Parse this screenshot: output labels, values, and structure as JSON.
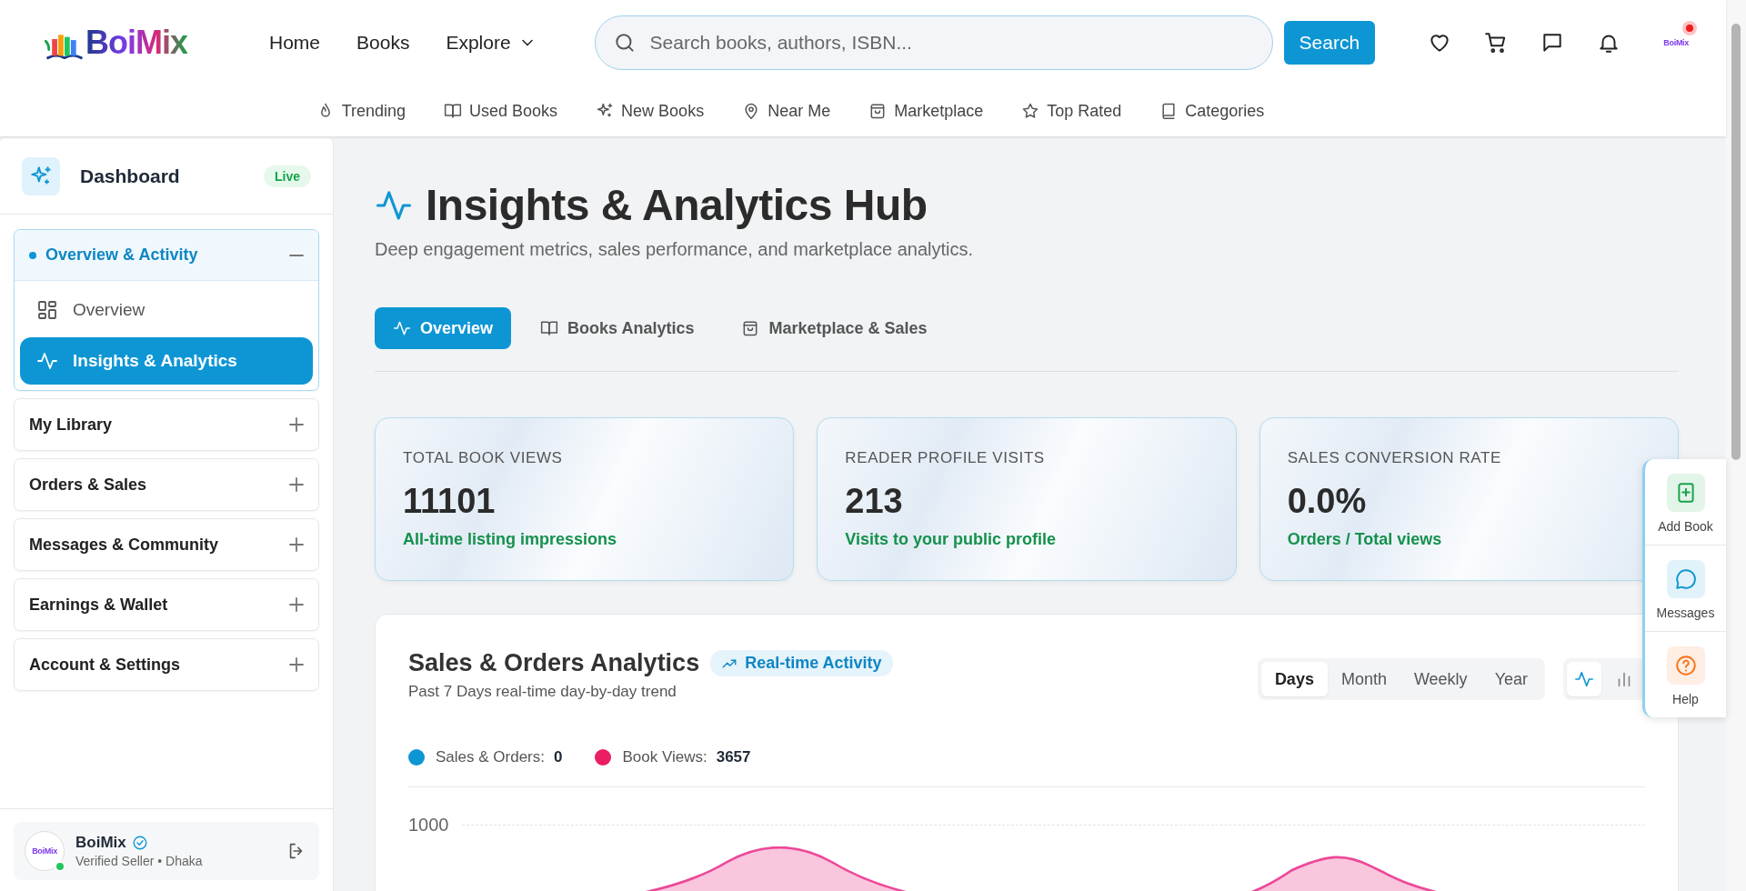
{
  "header": {
    "logo_text": "BoiMix",
    "nav": [
      {
        "label": "Home",
        "kind": "link"
      },
      {
        "label": "Books",
        "kind": "link"
      },
      {
        "label": "Explore",
        "kind": "dropdown"
      }
    ],
    "search": {
      "placeholder": "Search books, authors, ISBN..."
    },
    "search_button": "Search",
    "avatar": {
      "logo_text": "BoiMix",
      "unread": true
    },
    "subnav": [
      {
        "label": "Trending"
      },
      {
        "label": "Used Books"
      },
      {
        "label": "New Books"
      },
      {
        "label": "Near Me"
      },
      {
        "label": "Marketplace"
      },
      {
        "label": "Top Rated"
      },
      {
        "label": "Categories"
      }
    ]
  },
  "sidebar": {
    "title": "Dashboard",
    "badge": "Live",
    "groups": [
      {
        "label": "Overview & Activity",
        "expanded": true,
        "children": [
          {
            "label": "Overview",
            "selected": false
          },
          {
            "label": "Insights & Analytics",
            "selected": true
          }
        ]
      },
      {
        "label": "My Library",
        "expanded": false
      },
      {
        "label": "Orders & Sales",
        "expanded": false
      },
      {
        "label": "Messages & Community",
        "expanded": false
      },
      {
        "label": "Earnings & Wallet",
        "expanded": false
      },
      {
        "label": "Account & Settings",
        "expanded": false
      }
    ],
    "user": {
      "name": "BoiMix",
      "verified": true,
      "online": true,
      "subtitle": "Verified Seller • Dhaka",
      "avatar_text": "BoiMix"
    }
  },
  "page": {
    "title": "Insights & Analytics Hub",
    "subtitle": "Deep engagement metrics, sales performance, and marketplace analytics.",
    "tabs": [
      {
        "label": "Overview",
        "selected": true
      },
      {
        "label": "Books Analytics",
        "selected": false
      },
      {
        "label": "Marketplace & Sales",
        "selected": false
      }
    ],
    "stats": [
      {
        "label": "TOTAL BOOK VIEWS",
        "value": "11101",
        "note": "All-time listing impressions"
      },
      {
        "label": "READER PROFILE VISITS",
        "value": "213",
        "note": "Visits to your public profile"
      },
      {
        "label": "SALES CONVERSION RATE",
        "value": "0.0%",
        "note": "Orders / Total views"
      }
    ],
    "analytics": {
      "title": "Sales & Orders Analytics",
      "badge": "Real-time Activity",
      "subtitle": "Past 7 Days real-time day-by-day trend",
      "periods": [
        {
          "label": "Days",
          "selected": true
        },
        {
          "label": "Month",
          "selected": false
        },
        {
          "label": "Weekly",
          "selected": false
        },
        {
          "label": "Year",
          "selected": false
        }
      ],
      "chart_types": [
        {
          "kind": "line",
          "selected": true
        },
        {
          "kind": "bar",
          "selected": false
        }
      ],
      "legend": [
        {
          "label": "Sales & Orders:",
          "value": "0",
          "color": "#0e96d4"
        },
        {
          "label": "Book Views:",
          "value": "3657",
          "color": "#e91e63"
        }
      ],
      "y_tick": "1000"
    }
  },
  "quick_actions": [
    {
      "label": "Add Book",
      "color": "#16a34a"
    },
    {
      "label": "Messages",
      "color": "#0e96d4"
    },
    {
      "label": "Help",
      "color": "#f97316"
    }
  ]
}
